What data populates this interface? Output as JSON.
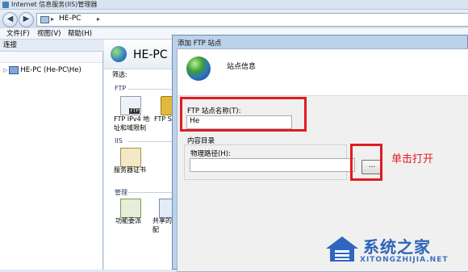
{
  "window": {
    "title": "Internet 信息服务(IIS)管理器"
  },
  "nav": {
    "back": "◀",
    "forward": "▶",
    "sep": "▸",
    "address": "HE-PC",
    "sep2": "▸"
  },
  "menu": {
    "file": "文件(F)",
    "view": "视图(V)",
    "help": "帮助(H)"
  },
  "connections": {
    "header": "连接",
    "tree_expander": "▷",
    "tree_node": "HE-PC (He-PC\\He)"
  },
  "home": {
    "title": "HE-PC 主",
    "filter_label": "筛选:",
    "groups": {
      "ftp": "FTP",
      "iis": "IIS",
      "management": "管理"
    },
    "features": [
      {
        "label": "FTP IPv4 地\n址和域限制"
      },
      {
        "label": "FTP SS"
      },
      {
        "label": "服务器证书"
      },
      {
        "label": "功能委派"
      },
      {
        "label": "共享的配"
      }
    ]
  },
  "dialog": {
    "title": "添加 FTP 站点",
    "step": "站点信息",
    "site_name_label": "FTP 站点名称(T):",
    "site_name_value": "He",
    "content_dir_label": "内容目录",
    "physical_path_label": "物理路径(H):",
    "physical_path_value": "",
    "browse_label": "..."
  },
  "annotation": {
    "text": "单击打开",
    "color": "#e11b22"
  },
  "watermark": {
    "logo_text": "系统之家",
    "url": "XITONGZHIJIA.NET"
  }
}
